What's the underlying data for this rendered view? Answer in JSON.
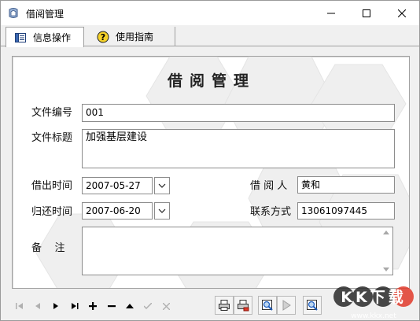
{
  "window": {
    "title": "借阅管理",
    "minimize_glyph": "—",
    "maximize_glyph": "☐",
    "close_glyph": "✕"
  },
  "tabs": [
    {
      "label": "信息操作",
      "icon": "document-list-icon",
      "active": true
    },
    {
      "label": "使用指南",
      "icon": "help-question-icon",
      "active": false
    }
  ],
  "form": {
    "title": "借阅管理",
    "file_no_label": "文件编号",
    "file_no_value": "001",
    "file_title_label": "文件标题",
    "file_title_value": "加强基层建设",
    "borrow_time_label": "借出时间",
    "borrow_time_value": "2007-05-27",
    "return_time_label": "归还时间",
    "return_time_value": "2007-06-20",
    "borrower_label": "借 阅 人",
    "borrower_value": "黄和",
    "contact_label": "联系方式",
    "contact_value": "13061097445",
    "remark_label": "备    注",
    "remark_value": ""
  },
  "navbar": {
    "buttons": [
      {
        "name": "first-record",
        "enabled": false
      },
      {
        "name": "prior-record",
        "enabled": false
      },
      {
        "name": "next-record",
        "enabled": true
      },
      {
        "name": "last-record",
        "enabled": true
      },
      {
        "name": "insert-record",
        "enabled": true
      },
      {
        "name": "delete-record",
        "enabled": true
      },
      {
        "name": "edit-record",
        "enabled": true
      },
      {
        "name": "post-record",
        "enabled": false
      },
      {
        "name": "cancel-record",
        "enabled": false
      }
    ],
    "tools": [
      {
        "name": "print-icon"
      },
      {
        "name": "print-preview-icon"
      },
      {
        "name": "search-icon"
      },
      {
        "name": "play-icon"
      },
      {
        "name": "zoom-icon"
      }
    ]
  },
  "watermark": {
    "text": "KK下载",
    "url": "www.kkx.net"
  },
  "colors": {
    "window_bg": "#f0f0f0",
    "border": "#a0a0a0",
    "field_border": "#8c8c8c",
    "accent_blue": "#1f5fbf",
    "watermark_red": "#e03a2a"
  }
}
